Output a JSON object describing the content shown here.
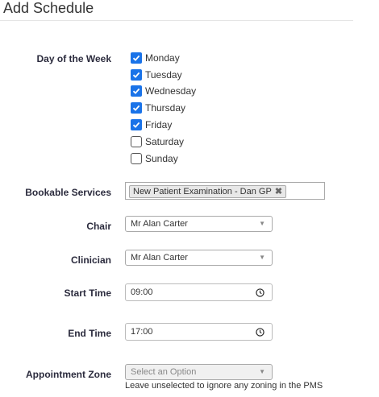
{
  "header": {
    "title": "Add Schedule"
  },
  "day_of_week": {
    "label": "Day of the Week",
    "days": [
      {
        "label": "Monday",
        "checked": true
      },
      {
        "label": "Tuesday",
        "checked": true
      },
      {
        "label": "Wednesday",
        "checked": true
      },
      {
        "label": "Thursday",
        "checked": true
      },
      {
        "label": "Friday",
        "checked": true
      },
      {
        "label": "Saturday",
        "checked": false
      },
      {
        "label": "Sunday",
        "checked": false
      }
    ]
  },
  "bookable_services": {
    "label": "Bookable Services",
    "selected_tag": "New Patient Examination - Dan GP",
    "remove_glyph": "✖"
  },
  "chair": {
    "label": "Chair",
    "value": "Mr Alan Carter"
  },
  "clinician": {
    "label": "Clinician",
    "value": "Mr Alan Carter"
  },
  "start_time": {
    "label": "Start Time",
    "value": "09:00"
  },
  "end_time": {
    "label": "End Time",
    "value": "17:00"
  },
  "appointment_zone": {
    "label": "Appointment Zone",
    "placeholder": "Select an Option",
    "hint": "Leave unselected to ignore any zoning in the PMS"
  },
  "dropdown_caret": "▼",
  "colors": {
    "checkbox_on": "#1a73e8",
    "label": "#2b2b3d"
  }
}
